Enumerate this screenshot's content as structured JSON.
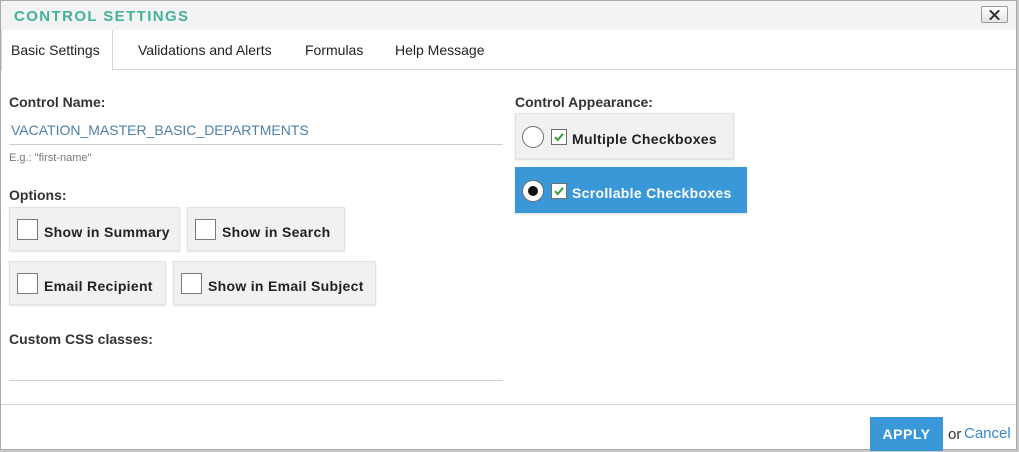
{
  "dialog": {
    "title": "CONTROL SETTINGS",
    "close_icon": "close-x-icon"
  },
  "tabs": [
    {
      "label": "Basic Settings",
      "active": true
    },
    {
      "label": "Validations and Alerts",
      "active": false
    },
    {
      "label": "Formulas",
      "active": false
    },
    {
      "label": "Help Message",
      "active": false
    }
  ],
  "basic": {
    "control_name_label": "Control Name:",
    "control_name_value": "VACATION_MASTER_BASIC_DEPARTMENTS",
    "control_name_hint": "E.g.: \"first-name\"",
    "options_label": "Options:",
    "options": [
      {
        "label": "Show in Summary",
        "checked": false
      },
      {
        "label": "Show in Search",
        "checked": false
      },
      {
        "label": "Email Recipient",
        "checked": false
      },
      {
        "label": "Show in Email Subject",
        "checked": false
      }
    ],
    "css_label": "Custom CSS classes:",
    "css_value": ""
  },
  "appearance": {
    "label": "Control Appearance:",
    "options": [
      {
        "label": "Multiple Checkboxes",
        "selected": false
      },
      {
        "label": "Scrollable Checkboxes",
        "selected": true
      }
    ]
  },
  "footer": {
    "apply_label": "APPLY",
    "or_text": "or",
    "cancel_label": "Cancel"
  },
  "colors": {
    "title": "#44b199",
    "accent": "#3a98d8",
    "link": "#3a87c8",
    "input_text": "#4f7fa6"
  }
}
